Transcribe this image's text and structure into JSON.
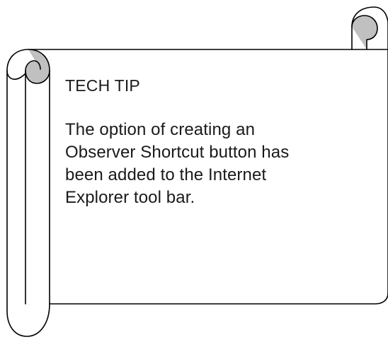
{
  "scroll": {
    "icon": "scroll-shape",
    "stroke_color": "#000000",
    "curl_fill_color": "#c0c0c0",
    "paper_color": "#ffffff"
  },
  "tech_tip": {
    "title": "TECH TIP",
    "body_lines": [
      "The option of creating an",
      "Observer Shortcut button has",
      "been added to the Internet",
      "Explorer tool bar."
    ]
  }
}
